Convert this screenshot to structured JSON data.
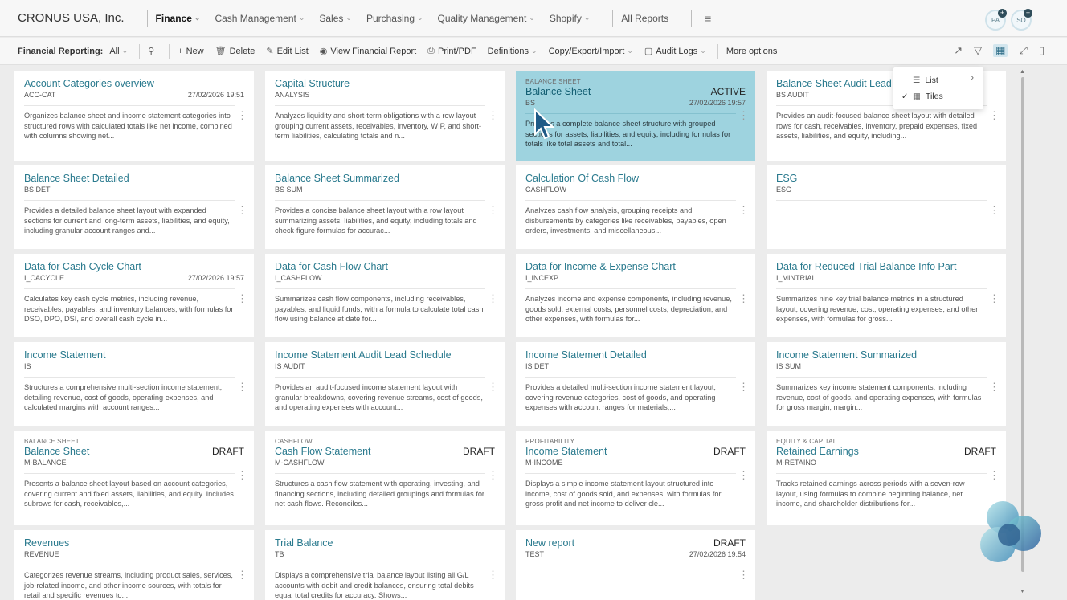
{
  "topnav": {
    "company": "CRONUS USA, Inc.",
    "items": [
      {
        "label": "Finance",
        "active": true
      },
      {
        "label": "Cash Management"
      },
      {
        "label": "Sales"
      },
      {
        "label": "Purchasing"
      },
      {
        "label": "Quality Management"
      },
      {
        "label": "Shopify"
      }
    ],
    "all_reports": "All Reports",
    "avatars": [
      "PA",
      "SO"
    ]
  },
  "actionbar": {
    "title": "Financial Reporting:",
    "filter": "All",
    "new": "New",
    "delete": "Delete",
    "edit_list": "Edit List",
    "view_report": "View Financial Report",
    "print": "Print/PDF",
    "definitions": "Definitions",
    "copy_export": "Copy/Export/Import",
    "audit_logs": "Audit Logs",
    "more": "More options"
  },
  "view_menu": {
    "list": "List",
    "tiles": "Tiles"
  },
  "tiles": [
    {
      "cat": "",
      "title": "Account Categories overview",
      "status": "",
      "code": "ACC-CAT",
      "date": "27/02/2026 19:51",
      "desc": "Organizes balance sheet and income statement categories into structured rows with calculated totals like net income, combined with columns showing net..."
    },
    {
      "cat": "",
      "title": "Capital Structure",
      "status": "",
      "code": "ANALYSIS",
      "date": "",
      "desc": "Analyzes liquidity and short-term obligations with a row layout grouping current assets, receivables, inventory, WIP, and short-term liabilities, calculating totals and n..."
    },
    {
      "cat": "BALANCE SHEET",
      "title": "Balance Sheet",
      "status": "ACTIVE",
      "code": "BS",
      "date": "27/02/2026 19:57",
      "desc": "Provides a complete balance sheet structure with grouped sections for assets, liabilities, and equity, including formulas for totals like total assets and total..."
    },
    {
      "cat": "",
      "title": "Balance Sheet Audit Lead S",
      "status": "",
      "code": "BS AUDIT",
      "date": "",
      "desc": "Provides an audit-focused balance sheet layout with detailed rows for cash, receivables, inventory, prepaid expenses, fixed assets, liabilities, and equity, including..."
    },
    {
      "cat": "",
      "title": "Balance Sheet Detailed",
      "status": "",
      "code": "BS DET",
      "date": "",
      "desc": "Provides a detailed balance sheet layout with expanded sections for current and long-term assets, liabilities, and equity, including granular account ranges and..."
    },
    {
      "cat": "",
      "title": "Balance Sheet Summarized",
      "status": "",
      "code": "BS SUM",
      "date": "",
      "desc": "Provides a concise balance sheet layout with a row layout summarizing assets, liabilities, and equity, including totals and check-figure formulas for accurac..."
    },
    {
      "cat": "",
      "title": "Calculation Of Cash Flow",
      "status": "",
      "code": "CASHFLOW",
      "date": "",
      "desc": "Analyzes cash flow analysis, grouping receipts and disbursements by categories like receivables, payables, open orders, investments, and miscellaneous..."
    },
    {
      "cat": "",
      "title": "ESG",
      "status": "",
      "code": "ESG",
      "date": "",
      "desc": ""
    },
    {
      "cat": "",
      "title": "Data for Cash Cycle Chart",
      "status": "",
      "code": "I_CACYCLE",
      "date": "27/02/2026 19:57",
      "desc": "Calculates key cash cycle metrics, including revenue, receivables, payables, and inventory balances, with formulas for DSO, DPO, DSI, and overall cash cycle in..."
    },
    {
      "cat": "",
      "title": "Data for Cash Flow Chart",
      "status": "",
      "code": "I_CASHFLOW",
      "date": "",
      "desc": "Summarizes cash flow components, including receivables, payables, and liquid funds, with a formula to calculate total cash flow using balance at date for..."
    },
    {
      "cat": "",
      "title": "Data for Income & Expense Chart",
      "status": "",
      "code": "I_INCEXP",
      "date": "",
      "desc": "Analyzes income and expense components, including revenue, goods sold, external costs, personnel costs, depreciation, and other expenses, with formulas for..."
    },
    {
      "cat": "",
      "title": "Data for Reduced Trial Balance Info Part",
      "status": "",
      "code": "I_MINTRIAL",
      "date": "",
      "desc": "Summarizes nine key trial balance metrics in a structured layout, covering revenue, cost, operating expenses, and other expenses, with formulas for gross..."
    },
    {
      "cat": "",
      "title": "Income Statement",
      "status": "",
      "code": "IS",
      "date": "",
      "desc": "Structures a comprehensive multi-section income statement, detailing revenue, cost of goods, operating expenses, and calculated margins with account ranges..."
    },
    {
      "cat": "",
      "title": "Income Statement Audit Lead Schedule",
      "status": "",
      "code": "IS AUDIT",
      "date": "",
      "desc": "Provides an audit-focused income statement layout with granular breakdowns, covering revenue streams, cost of goods, and operating expenses with account..."
    },
    {
      "cat": "",
      "title": "Income Statement Detailed",
      "status": "",
      "code": "IS DET",
      "date": "",
      "desc": "Provides a detailed multi-section income statement layout, covering revenue categories, cost of goods, and operating expenses with account ranges for materials,..."
    },
    {
      "cat": "",
      "title": "Income Statement Summarized",
      "status": "",
      "code": "IS SUM",
      "date": "",
      "desc": "Summarizes key income statement components, including revenue, cost of goods, and operating expenses, with formulas for gross margin, margin..."
    },
    {
      "cat": "BALANCE SHEET",
      "title": "Balance Sheet",
      "status": "DRAFT",
      "code": "M-BALANCE",
      "date": "",
      "desc": "Presents a balance sheet layout based on account categories, covering current and fixed assets, liabilities, and equity. Includes subrows for cash, receivables,..."
    },
    {
      "cat": "CASHFLOW",
      "title": "Cash Flow Statement",
      "status": "DRAFT",
      "code": "M-CASHFLOW",
      "date": "",
      "desc": "Structures a cash flow statement with operating, investing, and financing sections, including detailed groupings and formulas for net cash flows. Reconciles..."
    },
    {
      "cat": "PROFITABILITY",
      "title": "Income Statement",
      "status": "DRAFT",
      "code": "M-INCOME",
      "date": "",
      "desc": "Displays a simple income statement layout structured into income, cost of goods sold, and expenses, with formulas for gross profit and net income to deliver cle..."
    },
    {
      "cat": "EQUITY & CAPITAL",
      "title": "Retained Earnings",
      "status": "DRAFT",
      "code": "M-RETAINO",
      "date": "",
      "desc": "Tracks retained earnings across periods with a seven-row layout, using formulas to combine beginning balance, net income, and shareholder distributions for..."
    },
    {
      "cat": "",
      "title": "Revenues",
      "status": "",
      "code": "REVENUE",
      "date": "",
      "desc": "Categorizes revenue streams, including product sales, services, job-related income, and other income sources, with totals for retail and specific revenues to..."
    },
    {
      "cat": "",
      "title": "Trial Balance",
      "status": "",
      "code": "TB",
      "date": "",
      "desc": "Displays a comprehensive trial balance layout listing all G/L accounts with debit and credit balances, ensuring total debits equal total credits for accuracy. Shows..."
    },
    {
      "cat": "",
      "title": "New report",
      "status": "DRAFT",
      "code": "TEST",
      "date": "27/02/2026 19:54",
      "desc": ""
    }
  ],
  "colors": {
    "accent": "#2a7a8e",
    "selected_tile": "#9ed3df",
    "background": "#ececec"
  }
}
